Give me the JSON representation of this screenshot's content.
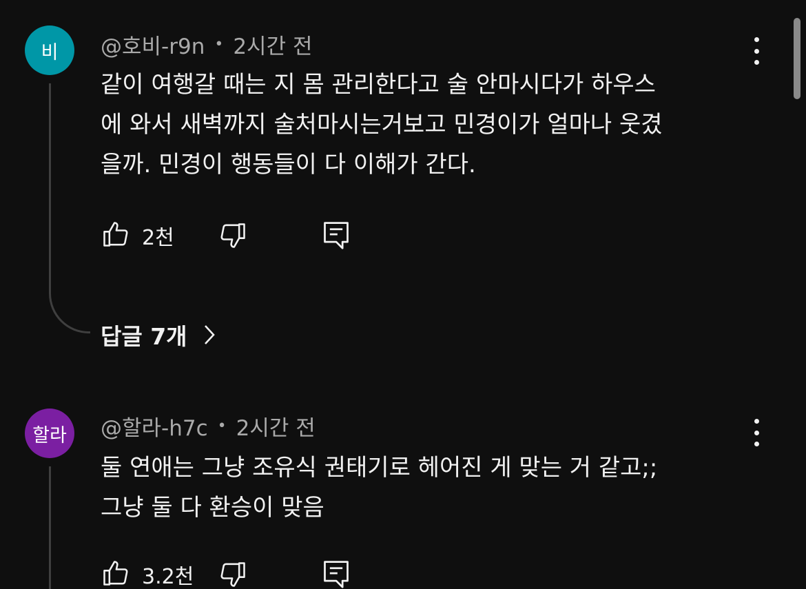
{
  "comments": [
    {
      "avatar_text": "비",
      "avatar_color": "#0097a7",
      "author": "@호비-r9n",
      "separator": "•",
      "time": "2시간 전",
      "text": "같이 여행갈 때는 지 몸 관리한다고 술 안마시다가 하우스\n에 와서 새벽까지 술처마시는거보고 민경이가 얼마나 웃겼\n을까. 민경이 행동들이 다 이해가 간다.",
      "likes": "2천",
      "replies_label": "답글 7개"
    },
    {
      "avatar_text": "할라",
      "avatar_color": "#7b1fa2",
      "author": "@할라-h7c",
      "separator": "•",
      "time": "2시간 전",
      "text": "둘 연애는 그냥 조유식 권태기로 헤어진 게 맞는 거 같고;;\n그냥 둘 다 환승이 맞음",
      "likes": "3.2천"
    }
  ],
  "icons": {
    "like": "thumb-up-icon",
    "dislike": "thumb-down-icon",
    "reply": "reply-comment-icon",
    "more": "more-vert-icon",
    "chevron": "chevron-right-icon"
  }
}
